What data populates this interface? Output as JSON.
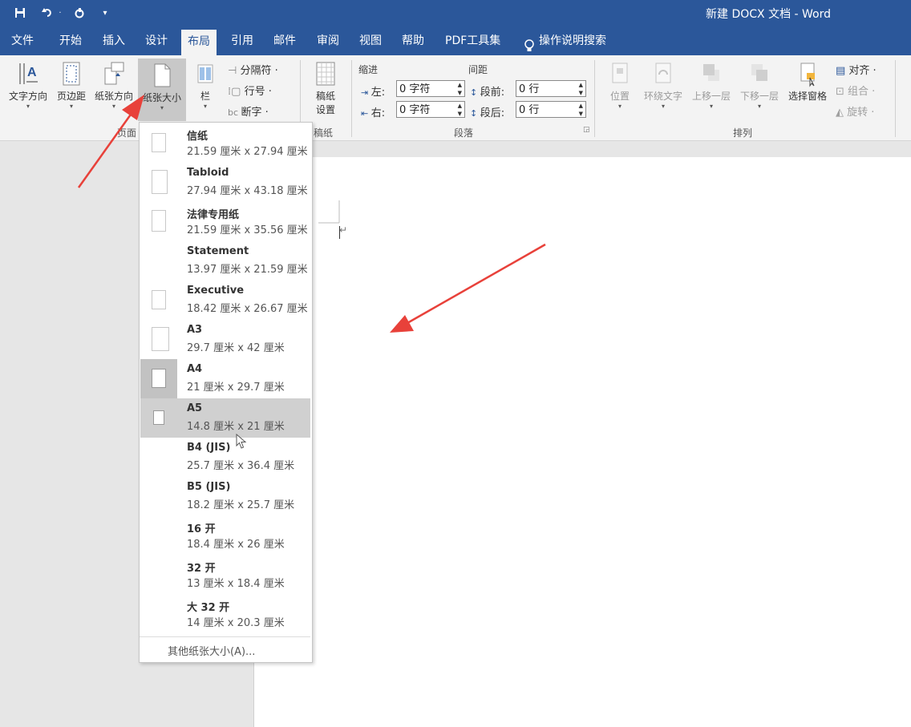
{
  "window": {
    "title": "新建 DOCX 文档  -  Word"
  },
  "quick_access": {
    "save_icon": "save-icon",
    "undo_icon": "undo-icon",
    "redo_icon": "redo-icon",
    "customize_icon": "customize-qat-icon"
  },
  "tabs": [
    "文件",
    "开始",
    "插入",
    "设计",
    "布局",
    "引用",
    "邮件",
    "审阅",
    "视图",
    "帮助",
    "PDF工具集"
  ],
  "active_tab": "布局",
  "tell_me": {
    "label": "操作说明搜索",
    "icon": "lightbulb-icon"
  },
  "ribbon": {
    "page_setup": {
      "group_label": "页面",
      "text_direction": "文字方向",
      "margins": "页边距",
      "orientation": "纸张方向",
      "size": "纸张大小",
      "columns": "栏",
      "breaks": "分隔符 ·",
      "line_numbers": "行号 ·",
      "hyphenation": "断字 ·"
    },
    "draft": {
      "label": "稿纸\n设置",
      "label_line1": "稿纸",
      "label_line2": "设置",
      "group_label": "稿纸"
    },
    "paragraph": {
      "group_label": "段落",
      "indent_label": "缩进",
      "spacing_label": "间距",
      "left_label": "左:",
      "right_label": "右:",
      "before_label": "段前:",
      "after_label": "段后:",
      "left_value": "0 字符",
      "right_value": "0 字符",
      "before_value": "0 行",
      "after_value": "0 行"
    },
    "arrange": {
      "group_label": "排列",
      "position": "位置",
      "wrap_text": "环绕文字",
      "bring_forward": "上移一层",
      "send_backward": "下移一层",
      "selection_pane": "选择窗格",
      "align": "对齐 ·",
      "group": "组合 ·",
      "rotate": "旋转 ·"
    }
  },
  "paper_sizes": [
    {
      "name": "信纸",
      "dims": "21.59 厘米 x 27.94 厘米"
    },
    {
      "name": "Tabloid",
      "dims": "27.94 厘米 x 43.18 厘米"
    },
    {
      "name": "法律专用纸",
      "dims": "21.59 厘米 x 35.56 厘米"
    },
    {
      "name": "Statement",
      "dims": "13.97 厘米 x 21.59 厘米"
    },
    {
      "name": "Executive",
      "dims": "18.42 厘米 x 26.67 厘米"
    },
    {
      "name": "A3",
      "dims": "29.7 厘米 x 42 厘米"
    },
    {
      "name": "A4",
      "dims": "21 厘米 x 29.7 厘米"
    },
    {
      "name": "A5",
      "dims": "14.8 厘米 x 21 厘米"
    },
    {
      "name": "B4 (JIS)",
      "dims": "25.7 厘米 x 36.4 厘米"
    },
    {
      "name": "B5 (JIS)",
      "dims": "18.2 厘米 x 25.7 厘米"
    },
    {
      "name": "16 开",
      "dims": "18.4 厘米 x 26 厘米"
    },
    {
      "name": "32 开",
      "dims": "13 厘米 x 18.4 厘米"
    },
    {
      "name": "大 32 开",
      "dims": "14 厘米 x 20.3 厘米"
    }
  ],
  "selected_paper": "A5",
  "current_paper": "A4",
  "more_sizes_label": "其他纸张大小(A)...",
  "colors": {
    "accent": "#2b579a",
    "annotation_arrow": "#e8413a"
  }
}
